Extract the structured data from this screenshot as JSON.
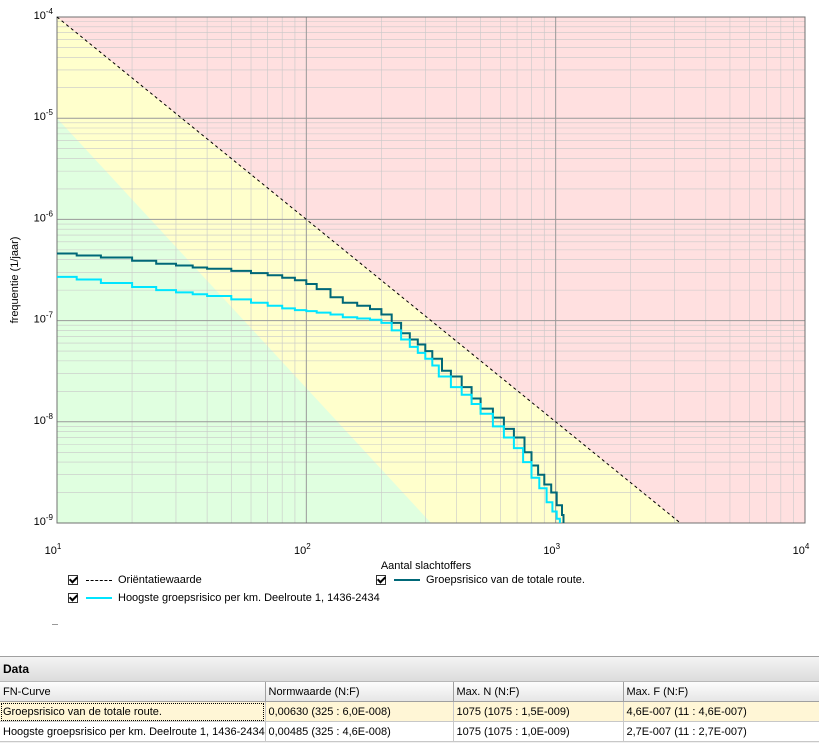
{
  "chart_data": {
    "type": "line",
    "xscale": "log",
    "yscale": "log",
    "xlim": [
      10,
      10000
    ],
    "ylim": [
      1e-09,
      0.0001
    ],
    "xlabel": "Aantal slachtoffers",
    "ylabel": "frequentie (1/jaar)",
    "x_ticks": [
      {
        "value": 10,
        "base": "10",
        "exp": "1"
      },
      {
        "value": 100,
        "base": "10",
        "exp": "2"
      },
      {
        "value": 1000,
        "base": "10",
        "exp": "3"
      },
      {
        "value": 10000,
        "base": "10",
        "exp": "4"
      }
    ],
    "y_ticks": [
      {
        "value": 0.0001,
        "base": "10",
        "exp": "-4"
      },
      {
        "value": 1e-05,
        "base": "10",
        "exp": "-5"
      },
      {
        "value": 1e-06,
        "base": "10",
        "exp": "-6"
      },
      {
        "value": 1e-07,
        "base": "10",
        "exp": "-7"
      },
      {
        "value": 1e-08,
        "base": "10",
        "exp": "-8"
      },
      {
        "value": 1e-09,
        "base": "10",
        "exp": "-9"
      }
    ],
    "grid": true,
    "regions": {
      "colors": {
        "red": "#ffe0e0",
        "yellow": "#ffffcc",
        "green": "#e0ffe0"
      }
    },
    "series": [
      {
        "name": "Oriëntatiewaarde",
        "style": "dashed",
        "color": "#000000",
        "points": [
          [
            10,
            0.0001
          ],
          [
            3162,
            1e-09
          ]
        ]
      },
      {
        "name": "Groepsrisico van de totale route.",
        "style": "step",
        "color": "#006878",
        "points": [
          [
            10,
            4.6e-07
          ],
          [
            12,
            4.4e-07
          ],
          [
            15,
            4.2e-07
          ],
          [
            20,
            3.9e-07
          ],
          [
            25,
            3.65e-07
          ],
          [
            30,
            3.5e-07
          ],
          [
            35,
            3.35e-07
          ],
          [
            40,
            3.25e-07
          ],
          [
            50,
            3.1e-07
          ],
          [
            60,
            2.95e-07
          ],
          [
            70,
            2.8e-07
          ],
          [
            80,
            2.65e-07
          ],
          [
            90,
            2.5e-07
          ],
          [
            100,
            2.3e-07
          ],
          [
            110,
            2.05e-07
          ],
          [
            125,
            1.7e-07
          ],
          [
            140,
            1.5e-07
          ],
          [
            160,
            1.4e-07
          ],
          [
            180,
            1.3e-07
          ],
          [
            200,
            1.15e-07
          ],
          [
            220,
            9.5e-08
          ],
          [
            240,
            7.5e-08
          ],
          [
            260,
            6.5e-08
          ],
          [
            280,
            5.8e-08
          ],
          [
            300,
            5e-08
          ],
          [
            320,
            4.2e-08
          ],
          [
            350,
            3.2e-08
          ],
          [
            380,
            2.8e-08
          ],
          [
            420,
            2.2e-08
          ],
          [
            460,
            1.7e-08
          ],
          [
            500,
            1.35e-08
          ],
          [
            560,
            1.1e-08
          ],
          [
            620,
            8.5e-09
          ],
          [
            680,
            7e-09
          ],
          [
            750,
            5e-09
          ],
          [
            800,
            3.7e-09
          ],
          [
            850,
            3e-09
          ],
          [
            900,
            2.4e-09
          ],
          [
            960,
            2e-09
          ],
          [
            1010,
            1.5e-09
          ],
          [
            1060,
            1.2e-09
          ],
          [
            1075,
            1e-09
          ]
        ]
      },
      {
        "name": "Hoogste groepsrisico per km. Deelroute 1, 1436-2434",
        "style": "step",
        "color": "#00e5ff",
        "points": [
          [
            10,
            2.7e-07
          ],
          [
            12,
            2.55e-07
          ],
          [
            15,
            2.35e-07
          ],
          [
            20,
            2.15e-07
          ],
          [
            25,
            2e-07
          ],
          [
            30,
            1.9e-07
          ],
          [
            35,
            1.82e-07
          ],
          [
            40,
            1.75e-07
          ],
          [
            50,
            1.62e-07
          ],
          [
            60,
            1.5e-07
          ],
          [
            70,
            1.4e-07
          ],
          [
            80,
            1.32e-07
          ],
          [
            90,
            1.27e-07
          ],
          [
            100,
            1.24e-07
          ],
          [
            110,
            1.2e-07
          ],
          [
            125,
            1.15e-07
          ],
          [
            140,
            1.08e-07
          ],
          [
            160,
            1.05e-07
          ],
          [
            180,
            1.02e-07
          ],
          [
            200,
            9.5e-08
          ],
          [
            220,
            8e-08
          ],
          [
            240,
            6.5e-08
          ],
          [
            260,
            5.5e-08
          ],
          [
            280,
            4.8e-08
          ],
          [
            300,
            4.2e-08
          ],
          [
            320,
            3.6e-08
          ],
          [
            340,
            2.8e-08
          ],
          [
            380,
            2.2e-08
          ],
          [
            420,
            1.85e-08
          ],
          [
            460,
            1.5e-08
          ],
          [
            500,
            1.2e-08
          ],
          [
            560,
            9e-09
          ],
          [
            620,
            7e-09
          ],
          [
            680,
            5.5e-09
          ],
          [
            740,
            4e-09
          ],
          [
            800,
            2.8e-09
          ],
          [
            860,
            2.2e-09
          ],
          [
            920,
            1.6e-09
          ],
          [
            970,
            1.3e-09
          ],
          [
            1010,
            1.1e-09
          ],
          [
            1040,
            1e-09
          ]
        ]
      }
    ]
  },
  "legend": {
    "items": [
      {
        "label": "Oriëntatiewaarde",
        "checked": true
      },
      {
        "label": "Groepsrisico van de totale route.",
        "checked": true
      },
      {
        "label": "Hoogste groepsrisico per km. Deelroute 1, 1436-2434",
        "checked": true
      }
    ]
  },
  "data_panel": {
    "title": "Data",
    "columns": [
      "FN-Curve",
      "Normwaarde (N:F)",
      "Max. N  (N:F)",
      "Max. F  (N:F)"
    ],
    "rows": [
      [
        "Groepsrisico van de totale route.",
        "0,00630 (325 : 6,0E-008)",
        "1075 (1075 : 1,5E-009)",
        "4,6E-007 (11 : 4,6E-007)"
      ],
      [
        "Hoogste groepsrisico per km. Deelroute 1, 1436-2434",
        "0,00485 (325 : 4,6E-008)",
        "1075 (1075 : 1,0E-009)",
        "2,7E-007 (11 : 2,7E-007)"
      ]
    ]
  }
}
